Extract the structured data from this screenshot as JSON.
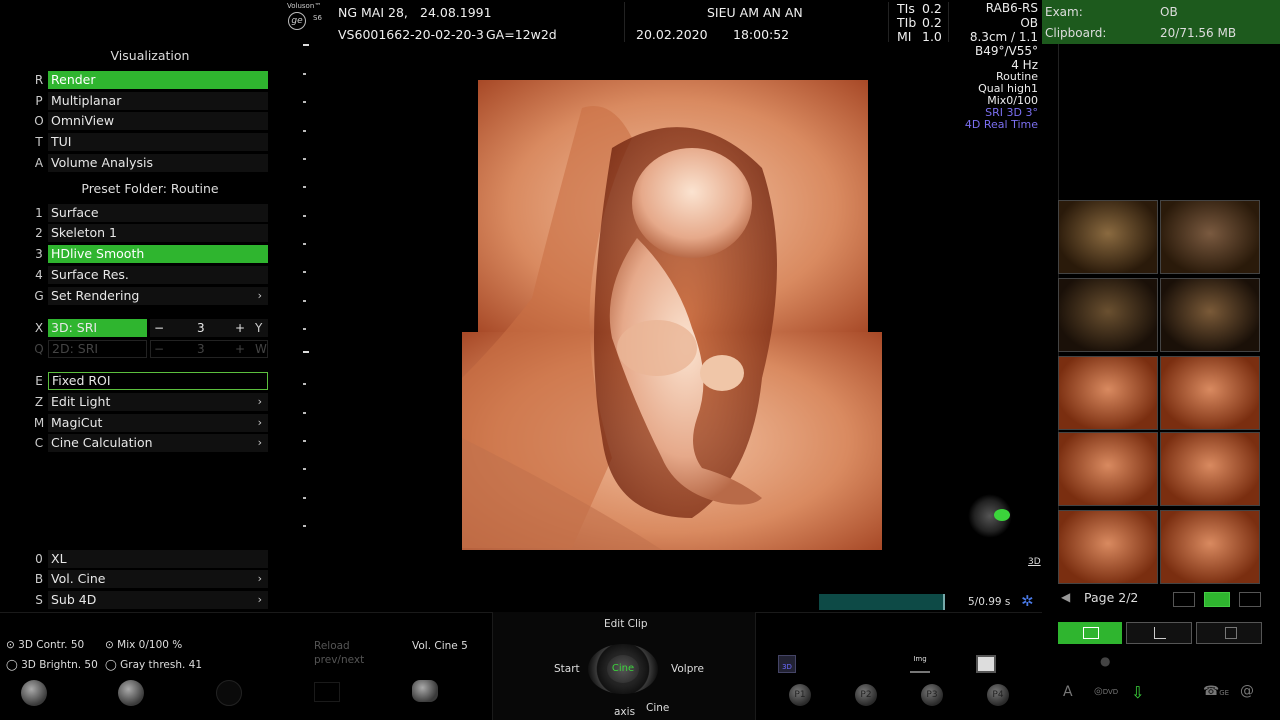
{
  "header": {
    "brand_line1": "Voluson™",
    "brand_line2": "S6",
    "patient_name": "NG MAI 28,",
    "patient_dob": "24.08.1991",
    "patient_id": "VS6001662-20-02-20-3",
    "ga": "GA=12w2d",
    "institution": "SIEU AM AN AN",
    "date": "20.02.2020",
    "time": "18:00:52",
    "tis_label": "TIs",
    "tis_value": "0.2",
    "tib_label": "TIb",
    "tib_value": "0.2",
    "mi_label": "MI",
    "mi_value": "1.0"
  },
  "probe": {
    "probe": "RAB6-RS",
    "app": "OB",
    "depth": "8.3cm / 1.1",
    "angles": "B49°/V55°",
    "rate": "4 Hz",
    "preset": "Routine",
    "quality": "Qual high1",
    "mix": "Mix0/100",
    "sri": "SRI 3D 3°",
    "mode": "4D Real Time"
  },
  "exam": {
    "exam_label": "Exam:",
    "exam_value": "OB",
    "clip_label": "Clipboard:",
    "clip_value": "20/71.56 MB"
  },
  "menu": {
    "title": "Visualization",
    "viz_items": [
      {
        "key": "R",
        "label": "Render"
      },
      {
        "key": "P",
        "label": "Multiplanar"
      },
      {
        "key": "O",
        "label": "OmniView"
      },
      {
        "key": "T",
        "label": "TUI"
      },
      {
        "key": "A",
        "label": "Volume Analysis"
      }
    ],
    "preset_title": "Preset Folder: Routine",
    "preset_items": [
      {
        "key": "1",
        "label": "Surface"
      },
      {
        "key": "2",
        "label": "Skeleton 1"
      },
      {
        "key": "3",
        "label": "HDlive Smooth"
      },
      {
        "key": "4",
        "label": "Surface Res."
      },
      {
        "key": "G",
        "label": "Set Rendering",
        "arrow": "›"
      }
    ],
    "x_key": "X",
    "x_label": "3D: SRI",
    "x_minus": "−",
    "x_value": "3",
    "x_plus": "+",
    "x_right": "Y",
    "q_key": "Q",
    "q_label": "2D: SRI",
    "q_minus": "−",
    "q_value": "3",
    "q_plus": "+",
    "q_right": "W",
    "tool_items": [
      {
        "key": "E",
        "label": "Fixed ROI"
      },
      {
        "key": "Z",
        "label": "Edit Light",
        "arrow": "›"
      },
      {
        "key": "M",
        "label": "MagiCut",
        "arrow": "›"
      },
      {
        "key": "C",
        "label": "Cine Calculation",
        "arrow": "›"
      }
    ],
    "bottom_items": [
      {
        "key": "0",
        "label": "XL"
      },
      {
        "key": "B",
        "label": "Vol. Cine",
        "arrow": "›"
      },
      {
        "key": "S",
        "label": "Sub 4D",
        "arrow": "›"
      }
    ]
  },
  "cine": {
    "frames": "5/0.99 s",
    "tag_3d": "3D"
  },
  "pages": {
    "label": "Page 2/2"
  },
  "bottom": {
    "contr": "3D Contr. 50",
    "mix": "Mix 0/100 %",
    "brightn": "3D Brightn. 50",
    "gray": "Gray thresh. 41",
    "reload1": "Reload",
    "reload2": "prev/next",
    "volcine": "Vol. Cine 5",
    "edit_clip": "Edit Clip",
    "start": "Start",
    "cine": "Cine",
    "volpre": "Volpre",
    "axis": "axis",
    "cine2": "Cine",
    "p1": "P1",
    "p2": "P2",
    "p3": "P3",
    "p4": "P4",
    "img_tag": "Img",
    "dvd": "DVD",
    "ge": "GE"
  },
  "colors": {
    "accent_green": "#2fb52f",
    "exam_bar": "#1d5a1d",
    "volume_flesh": "#d98a60"
  }
}
